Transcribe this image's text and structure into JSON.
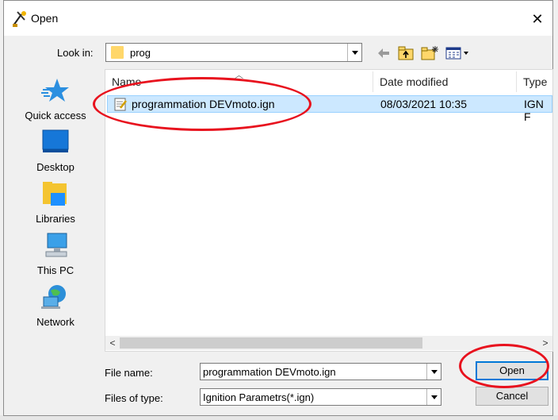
{
  "window": {
    "title": "Open",
    "close_glyph": "✕"
  },
  "look_in": {
    "label": "Look in:",
    "value": "prog"
  },
  "toolbar": {
    "icons": [
      "back-arrow-icon",
      "up-folder-icon",
      "new-folder-icon",
      "view-menu-icon"
    ]
  },
  "places": [
    {
      "label": "Quick access",
      "icon": "star-icon"
    },
    {
      "label": "Desktop",
      "icon": "desktop-icon"
    },
    {
      "label": "Libraries",
      "icon": "libraries-icon"
    },
    {
      "label": "This PC",
      "icon": "computer-icon"
    },
    {
      "label": "Network",
      "icon": "network-icon"
    }
  ],
  "file_list": {
    "columns": [
      "Name",
      "Date modified",
      "Type"
    ],
    "rows": [
      {
        "name": "programmation DEVmoto.ign",
        "date_modified": "08/03/2021 10:35",
        "type": "IGN F",
        "selected": true
      }
    ]
  },
  "scrollbar": {
    "left_glyph": "<",
    "right_glyph": ">"
  },
  "file_name": {
    "label": "File name:",
    "value": "programmation DEVmoto.ign"
  },
  "file_type": {
    "label": "Files of type:",
    "value": "Ignition Parametrs(*.ign)"
  },
  "buttons": {
    "open": "Open",
    "cancel": "Cancel"
  },
  "colors": {
    "selection": "#cce8ff",
    "annotation": "#e8121e",
    "accent": "#0078d7"
  }
}
